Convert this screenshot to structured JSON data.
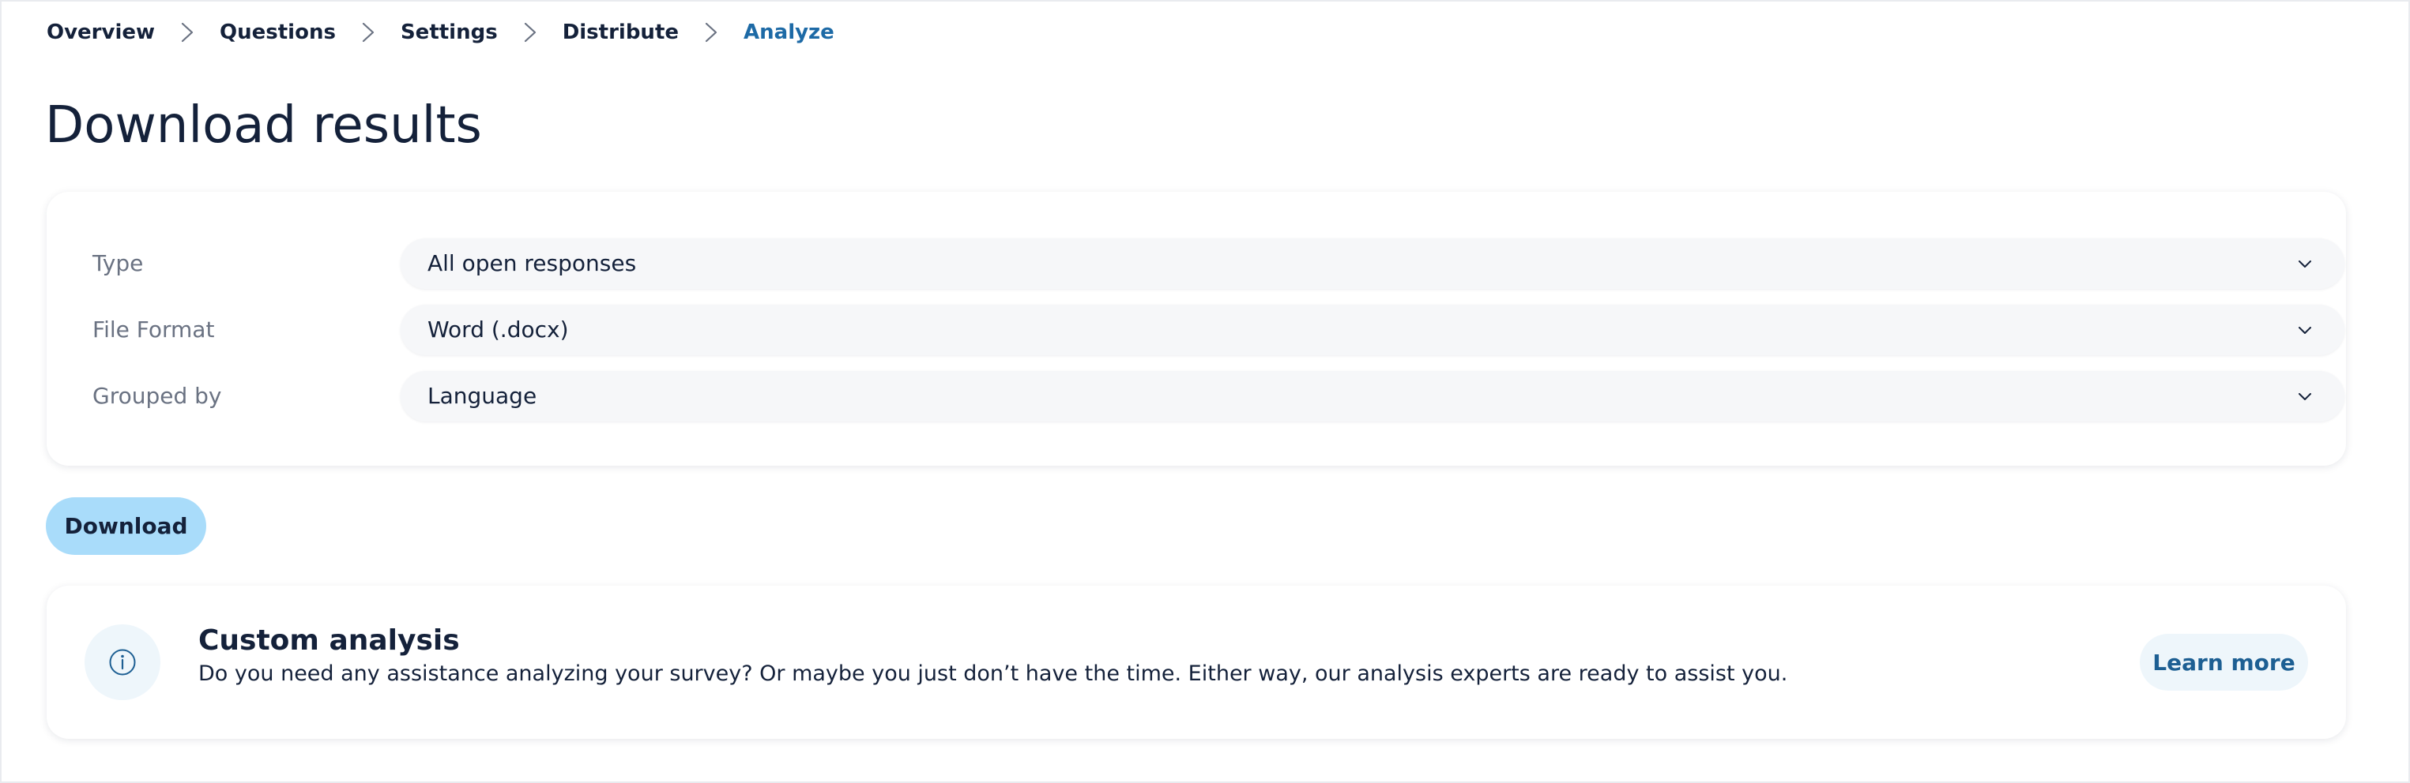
{
  "breadcrumb": {
    "items": [
      {
        "label": "Overview",
        "active": false
      },
      {
        "label": "Questions",
        "active": false
      },
      {
        "label": "Settings",
        "active": false
      },
      {
        "label": "Distribute",
        "active": false
      },
      {
        "label": "Analyze",
        "active": true
      }
    ],
    "separator_icon": "chevron-right-icon"
  },
  "page": {
    "title": "Download results"
  },
  "settings": {
    "fields": [
      {
        "label": "Type",
        "value": "All open responses",
        "icon": "chevron-down-icon"
      },
      {
        "label": "File Format",
        "value": "Word (.docx)",
        "icon": "chevron-down-icon"
      },
      {
        "label": "Grouped by",
        "value": "Language",
        "icon": "chevron-down-icon"
      }
    ]
  },
  "actions": {
    "download_label": "Download"
  },
  "custom_analysis": {
    "icon": "info-icon",
    "title": "Custom analysis",
    "description": "Do you need any assistance analyzing your survey? Or maybe you just don’t have the time. Either way, our analysis experts are ready to assist you.",
    "button_label": "Learn more"
  },
  "colors": {
    "text": "#14213a",
    "active_link": "#1d6aa6",
    "primary_button": "#a9dcfa",
    "muted_label": "#6a7282",
    "select_background": "#f6f7f9",
    "info_background": "#eef6fb"
  }
}
